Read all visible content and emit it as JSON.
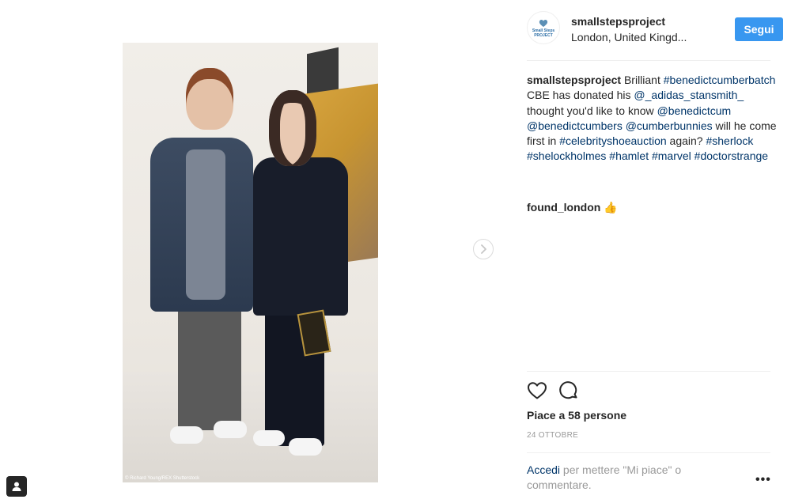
{
  "post": {
    "photo_credit": "© Richard Young/REX Shutterstock"
  },
  "header": {
    "avatar_text_line1": "Small Steps",
    "avatar_text_line2": "PROJECT",
    "username": "smallstepsproject",
    "location": "London, United Kingd...",
    "follow_label": "Segui"
  },
  "caption": {
    "username": "smallstepsproject",
    "t1": " Brilliant ",
    "h1": "#benedictcumberbatch",
    "t2": " CBE has donated his ",
    "m1": "@_adidas_stansmith_",
    "t3": " thought you'd like to know ",
    "m2": "@benedictcum",
    "t4": " ",
    "m3": "@benedictcumbers",
    "t5": " ",
    "m4": "@cumberbunnies",
    "t6": " will he come first in ",
    "h2": "#celebrityshoeauction",
    "t7": " again? ",
    "h3": "#sherlock",
    "t8": " ",
    "h4": "#shelockholmes",
    "t9": " ",
    "h5": "#hamlet",
    "t10": " ",
    "h6": "#marvel",
    "t11": " ",
    "h7": "#doctorstrange"
  },
  "comments": [
    {
      "username": "found_london",
      "text": " 👍"
    }
  ],
  "stats": {
    "likes": "Piace a 58 persone",
    "date": "24 OTTOBRE"
  },
  "login_prompt": {
    "link": "Accedi",
    "text": " per mettere \"Mi piace\" o commentare."
  },
  "more_label": "•••",
  "icons": {
    "like": "heart-icon",
    "comment": "comment-icon",
    "next": "chevron-right-icon",
    "tag": "user-tag-icon"
  }
}
